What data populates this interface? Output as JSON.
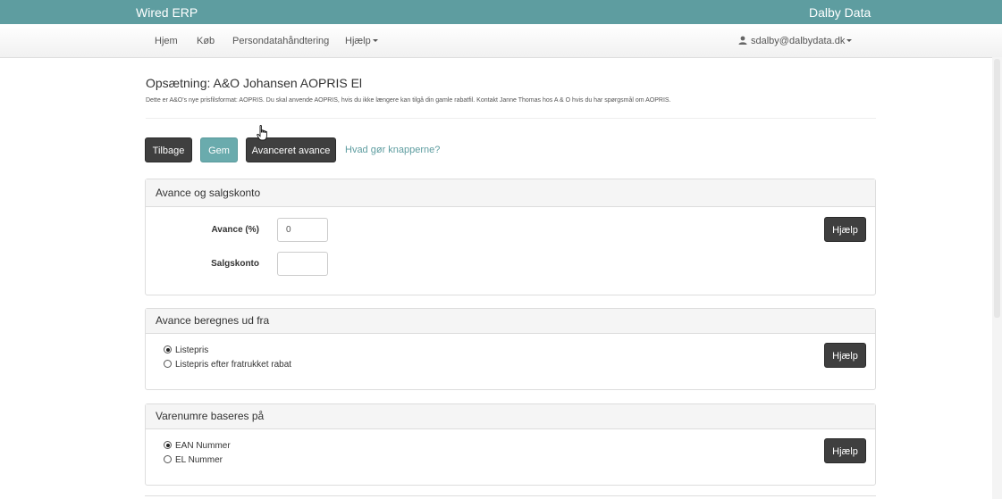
{
  "app": {
    "title": "Wired ERP",
    "company": "Dalby Data"
  },
  "nav": {
    "items": [
      "Hjem",
      "Køb",
      "Persondatahåndtering",
      "Hjælp"
    ],
    "user": "sdalby@dalbydata.dk"
  },
  "page": {
    "title": "Opsætning: A&O Johansen AOPRIS El",
    "description": "Dette er A&O's nye prisfilsformat: AOPRIS. Du skal anvende AOPRIS, hvis du ikke længere kan tilgå din gamle rabatfil. Kontakt Janne Thomas hos A & O hvis du har spørgsmål om AOPRIS."
  },
  "toolbar": {
    "back_label": "Tilbage",
    "save_label": "Gem",
    "advanced_label": "Avanceret avance",
    "help_link": "Hvad gør knapperne?"
  },
  "panels": {
    "markup": {
      "heading": "Avance og salgskonto",
      "markup_label": "Avance (%)",
      "markup_value": "0",
      "account_label": "Salgskonto",
      "account_value": "",
      "help_label": "Hjælp"
    },
    "basis": {
      "heading": "Avance beregnes ud fra",
      "options": [
        "Listepris",
        "Listepris efter fratrukket rabat"
      ],
      "selected": "Listepris",
      "help_label": "Hjælp"
    },
    "itemnumbers": {
      "heading": "Varenumre baseres på",
      "options": [
        "EAN Nummer",
        "EL Nummer"
      ],
      "selected": "EAN Nummer",
      "help_label": "Hjælp"
    }
  },
  "colors": {
    "topbar": "#5e9da0",
    "save_button": "#6aabad",
    "dark_button": "#3f3f3f"
  }
}
